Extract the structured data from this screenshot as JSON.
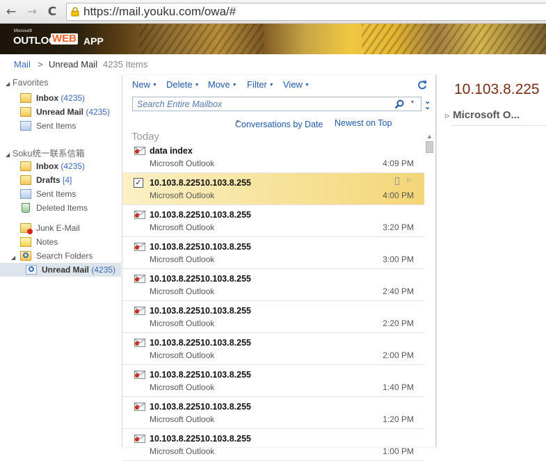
{
  "browser": {
    "back_glyph": "←",
    "forward_glyph": "→",
    "reload_glyph": "C",
    "url": "https://mail.youku.com/owa/#"
  },
  "banner": {
    "logo_microsoft": "Microsoft",
    "logo_outlook": "OUTLOOK",
    "logo_web": "WEB",
    "logo_app": "APP",
    "accent_color": "#f0632a"
  },
  "breadcrumb": {
    "root": "Mail",
    "separator": ">",
    "current": "Unread Mail",
    "count": "4235 Items"
  },
  "sidebar": {
    "favorites_header": "Favorites",
    "favorites": [
      {
        "label": "Inbox",
        "count": "(4235)",
        "icon": "inbox-icon",
        "bold": true
      },
      {
        "label": "Unread Mail",
        "count": "(4235)",
        "icon": "search-folder-icon",
        "bold": true
      },
      {
        "label": "Sent Items",
        "count": "",
        "icon": "sent-items-icon",
        "bold": false
      }
    ],
    "mailbox_header": "Soku统一联系信箱",
    "folders": [
      {
        "label": "Inbox",
        "count": "(4235)",
        "icon": "inbox-icon",
        "bold": true
      },
      {
        "label": "Drafts",
        "count": "[4]",
        "icon": "drafts-icon",
        "bold": true
      },
      {
        "label": "Sent Items",
        "count": "",
        "icon": "sent-items-icon",
        "bold": false
      },
      {
        "label": "Deleted Items",
        "count": "",
        "icon": "deleted-items-icon",
        "bold": false
      },
      {
        "label": "Junk E-Mail",
        "count": "",
        "icon": "junk-email-icon",
        "bold": false
      },
      {
        "label": "Notes",
        "count": "",
        "icon": "notes-icon",
        "bold": false
      },
      {
        "label": "Search Folders",
        "count": "",
        "icon": "search-folders-icon",
        "bold": false
      },
      {
        "label": "Unread Mail",
        "count": "(4235)",
        "icon": "search-folder-icon",
        "bold": true,
        "selected": true
      }
    ]
  },
  "toolbar": {
    "new_label": "New",
    "delete_label": "Delete",
    "move_label": "Move",
    "filter_label": "Filter",
    "view_label": "View"
  },
  "search": {
    "placeholder": "Search Entire Mailbox"
  },
  "sort": {
    "arrange_by": "Conversations by Date",
    "order": "Newest on Top"
  },
  "group_label": "Today",
  "messages": [
    {
      "subject": "data index",
      "from": "Microsoft Outlook",
      "time": "4:09 PM",
      "selected": false
    },
    {
      "subject": "10.103.8.22510.103.8.255",
      "from": "Microsoft Outlook",
      "time": "4:00 PM",
      "selected": true
    },
    {
      "subject": "10.103.8.22510.103.8.255",
      "from": "Microsoft Outlook",
      "time": "3:20 PM",
      "selected": false
    },
    {
      "subject": "10.103.8.22510.103.8.255",
      "from": "Microsoft Outlook",
      "time": "3:00 PM",
      "selected": false
    },
    {
      "subject": "10.103.8.22510.103.8.255",
      "from": "Microsoft Outlook",
      "time": "2:40 PM",
      "selected": false
    },
    {
      "subject": "10.103.8.22510.103.8.255",
      "from": "Microsoft Outlook",
      "time": "2:20 PM",
      "selected": false
    },
    {
      "subject": "10.103.8.22510.103.8.255",
      "from": "Microsoft Outlook",
      "time": "2:00 PM",
      "selected": false
    },
    {
      "subject": "10.103.8.22510.103.8.255",
      "from": "Microsoft Outlook",
      "time": "1:40 PM",
      "selected": false
    },
    {
      "subject": "10.103.8.22510.103.8.255",
      "from": "Microsoft Outlook",
      "time": "1:20 PM",
      "selected": false
    },
    {
      "subject": "10.103.8.22510.103.8.255",
      "from": "Microsoft Outlook",
      "time": "1:00 PM",
      "selected": false
    }
  ],
  "reading_pane": {
    "title": "10.103.8.225",
    "sender": "Microsoft O..."
  }
}
